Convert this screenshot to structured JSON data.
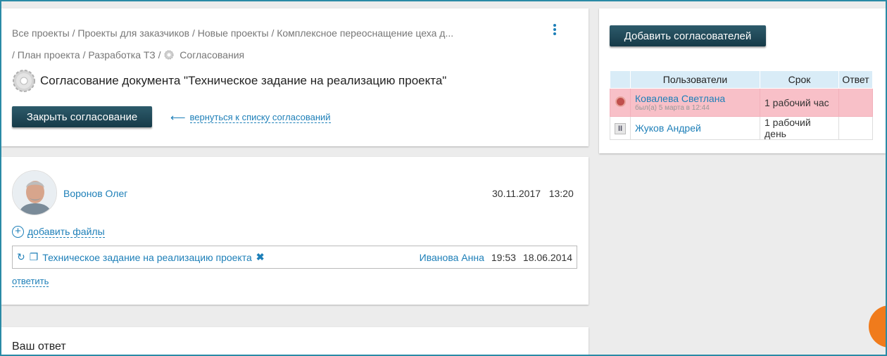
{
  "breadcrumbs": {
    "line1": [
      "Все проекты",
      "Проекты для заказчиков",
      "Новые проекты",
      "Комплексное переоснащение цеха д..."
    ],
    "line2": [
      "План проекта",
      "Разработка ТЗ",
      "Согласования"
    ],
    "separator": "/"
  },
  "page": {
    "title": "Согласование документа \"Техническое задание на реализацию проекта\"",
    "close_button": "Закрыть согласование",
    "back_link": "вернуться к списку согласований",
    "back_arrow": "⟵"
  },
  "comment": {
    "author": "Воронов Олег",
    "date": "30.11.2017",
    "time": "13:20",
    "add_files": "добавить файлы",
    "reply": "ответить",
    "file": {
      "name": "Техническое задание на реализацию проекта",
      "person": "Иванова Анна",
      "time": "19:53",
      "date": "18.06.2014"
    }
  },
  "answer": {
    "title": "Ваш ответ"
  },
  "approvers": {
    "add_button": "Добавить согласователей",
    "columns": [
      "Пользователи",
      "Срок",
      "Ответ"
    ],
    "rows": [
      {
        "status_icon": "clock-icon",
        "user": "Ковалева Светлана",
        "seen": "был(а) 5 марта в 12:44",
        "deadline": "1 рабочий час",
        "answer": "",
        "highlight": "#f8c0c8"
      },
      {
        "status_icon": "pause-icon",
        "user": "Жуков Андрей",
        "seen": "",
        "deadline": "1 рабочий день",
        "answer": ""
      }
    ]
  },
  "colors": {
    "accent": "#1d7fb8",
    "button_dark": "#1f4656",
    "late_row": "#f8c0c8",
    "header_row": "#d9ecf7",
    "orange_widget": "#f07b1c"
  }
}
